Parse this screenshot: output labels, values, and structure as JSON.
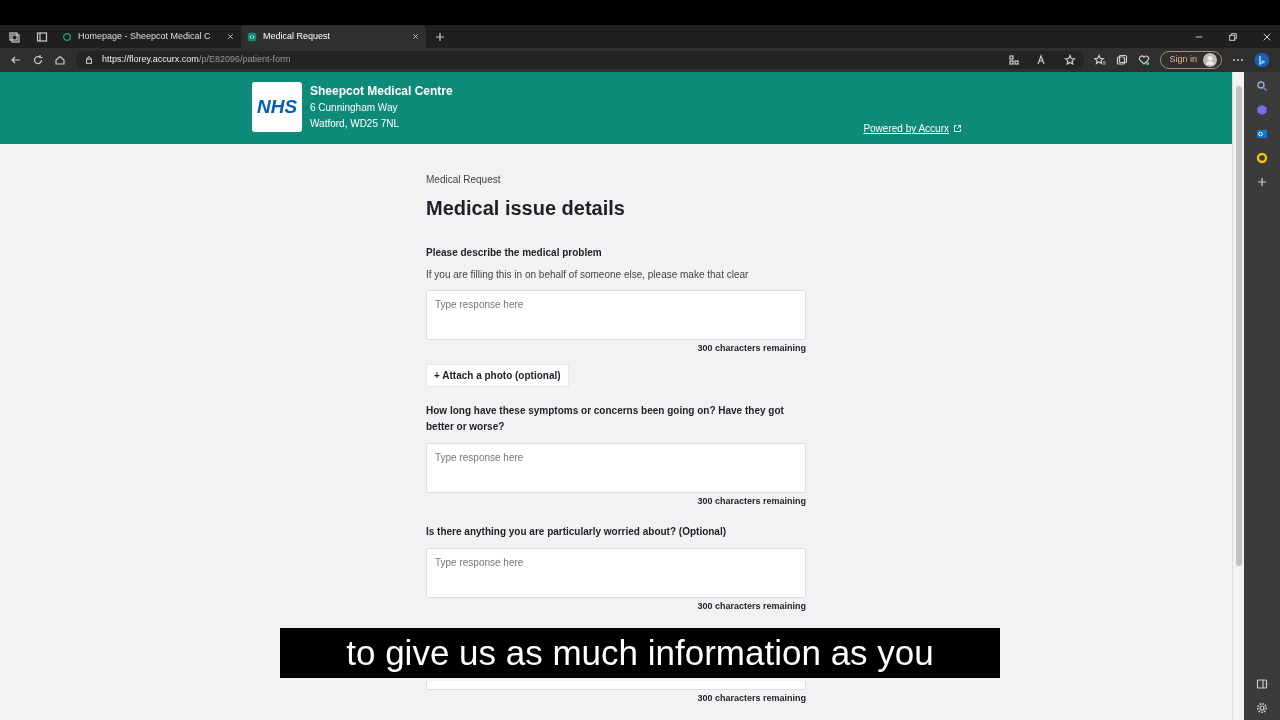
{
  "browser": {
    "tabs": [
      {
        "title": "Homepage - Sheepcot Medical C",
        "selected": false
      },
      {
        "title": "Medical Request",
        "selected": true
      }
    ],
    "url_host": "https://florey.accurx.com",
    "url_path": "/p/E82096/patient-form",
    "sign_in": "Sign in"
  },
  "header": {
    "logo": "NHS",
    "practice_name": "Sheepcot Medical Centre",
    "address_lines": [
      "6 Cunningham Way",
      "Watford, WD25 7NL"
    ],
    "powered_by": "Powered by Accurx"
  },
  "form": {
    "breadcrumb": "Medical Request",
    "title": "Medical issue details",
    "questions": [
      {
        "label": "Please describe the medical problem",
        "hint": "If you are filling this in on behalf of someone else, please make that clear",
        "placeholder": "Type response here",
        "counter": "300 characters remaining",
        "attach": "+ Attach a photo (optional)"
      },
      {
        "label": "How long have these symptoms or concerns been going on? Have they got better or worse?",
        "placeholder": "Type response here",
        "counter": "300 characters remaining"
      },
      {
        "label": "Is there anything you are particularly worried about? (Optional)",
        "placeholder": "Type response here",
        "counter": "300 characters remaining"
      },
      {
        "counter": "300 characters remaining"
      }
    ]
  },
  "caption": "to give us as much information as you"
}
